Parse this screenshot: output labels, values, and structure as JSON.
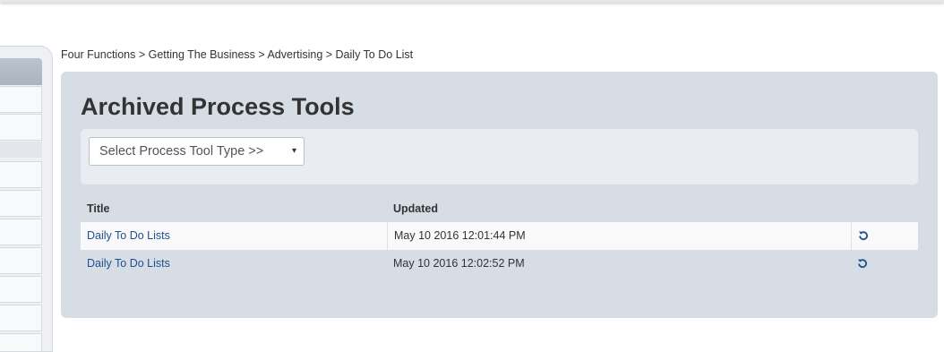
{
  "breadcrumb": {
    "text": "Four Functions > Getting The Business > Advertising > Daily To Do List"
  },
  "panel": {
    "title": "Archived Process Tools"
  },
  "filter": {
    "select_label": "Select Process Tool Type >>",
    "caret": "▾"
  },
  "table": {
    "headers": {
      "title": "Title",
      "updated": "Updated",
      "action": ""
    },
    "rows": [
      {
        "title": "Daily To Do Lists",
        "updated": "May 10 2016 12:01:44 PM",
        "action_icon": "restore-icon"
      },
      {
        "title": "Daily To Do Lists",
        "updated": "May 10 2016 12:02:52 PM",
        "action_icon": "restore-icon"
      }
    ]
  },
  "colors": {
    "link": "#1f4f8f",
    "panel_bg": "#d6dde5",
    "filter_bg": "#e9edf1"
  }
}
